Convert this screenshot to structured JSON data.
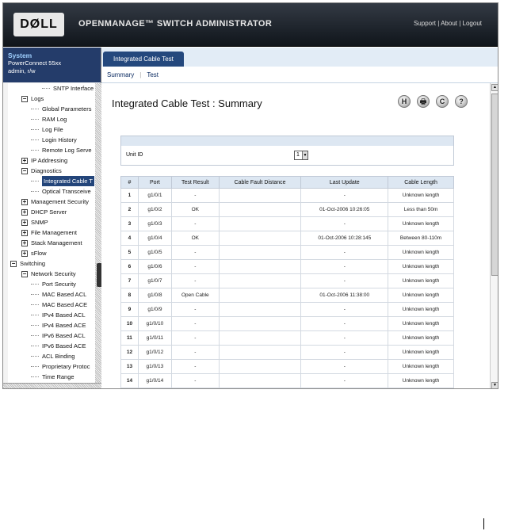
{
  "header": {
    "logo": "DØLL",
    "app_title": "OPENMANAGE™ SWITCH ADMINISTRATOR",
    "links": [
      "Support",
      "About",
      "Logout"
    ]
  },
  "system": {
    "title": "System",
    "model": "PowerConnect 55xx",
    "user": "admin, r/w"
  },
  "tree": [
    {
      "label": "SNTP Interface Se",
      "indent": 3,
      "box": ""
    },
    {
      "label": "Logs",
      "indent": 1,
      "box": "−"
    },
    {
      "label": "Global Parameters",
      "indent": 2,
      "box": ""
    },
    {
      "label": "RAM Log",
      "indent": 2,
      "box": ""
    },
    {
      "label": "Log File",
      "indent": 2,
      "box": ""
    },
    {
      "label": "Login History",
      "indent": 2,
      "box": ""
    },
    {
      "label": "Remote Log Serve",
      "indent": 2,
      "box": ""
    },
    {
      "label": "IP Addressing",
      "indent": 1,
      "box": "+"
    },
    {
      "label": "Diagnostics",
      "indent": 1,
      "box": "−"
    },
    {
      "label": "Integrated Cable T",
      "indent": 2,
      "box": "",
      "selected": true
    },
    {
      "label": "Optical Transceive",
      "indent": 2,
      "box": ""
    },
    {
      "label": "Management Security",
      "indent": 1,
      "box": "+"
    },
    {
      "label": "DHCP Server",
      "indent": 1,
      "box": "+"
    },
    {
      "label": "SNMP",
      "indent": 1,
      "box": "+"
    },
    {
      "label": "File Management",
      "indent": 1,
      "box": "+"
    },
    {
      "label": "Stack Management",
      "indent": 1,
      "box": "+"
    },
    {
      "label": "sFlow",
      "indent": 1,
      "box": "+"
    },
    {
      "label": "Switching",
      "indent": 0,
      "box": "−"
    },
    {
      "label": "Network Security",
      "indent": 1,
      "box": "−"
    },
    {
      "label": "Port Security",
      "indent": 2,
      "box": ""
    },
    {
      "label": "MAC Based ACL",
      "indent": 2,
      "box": ""
    },
    {
      "label": "MAC Based ACE",
      "indent": 2,
      "box": ""
    },
    {
      "label": "IPv4 Based ACL",
      "indent": 2,
      "box": ""
    },
    {
      "label": "IPv4 Based ACE",
      "indent": 2,
      "box": ""
    },
    {
      "label": "IPv6 Based ACL",
      "indent": 2,
      "box": ""
    },
    {
      "label": "IPv6 Based ACE",
      "indent": 2,
      "box": ""
    },
    {
      "label": "ACL Binding",
      "indent": 2,
      "box": ""
    },
    {
      "label": "Proprietary Protoc",
      "indent": 2,
      "box": ""
    },
    {
      "label": "Time Range",
      "indent": 2,
      "box": ""
    }
  ],
  "tab": {
    "label": "Integrated Cable Test"
  },
  "subnav": {
    "summary": "Summary",
    "test": "Test"
  },
  "page": {
    "title": "Integrated Cable Test : Summary"
  },
  "icons": {
    "save": "H",
    "print": "🖶",
    "refresh": "C",
    "help": "?"
  },
  "unit": {
    "label": "Unit ID",
    "value": "1"
  },
  "table": {
    "headers": [
      "#",
      "Port",
      "Test Result",
      "Cable Fault Distance",
      "Last Update",
      "Cable Length"
    ],
    "rows": [
      [
        "1",
        "g1/0/1",
        "-",
        "",
        "-",
        "Unknown length"
      ],
      [
        "2",
        "g1/0/2",
        "OK",
        "",
        "01-Oct-2006 10:26:05",
        "Less than 50m"
      ],
      [
        "3",
        "g1/0/3",
        "-",
        "",
        "-",
        "Unknown length"
      ],
      [
        "4",
        "g1/0/4",
        "OK",
        "",
        "01-Oct-2006 10:28:145",
        "Between 80-110m"
      ],
      [
        "5",
        "g1/0/5",
        "-",
        "",
        "-",
        "Unknown length"
      ],
      [
        "6",
        "g1/0/6",
        "-",
        "",
        "-",
        "Unknown length"
      ],
      [
        "7",
        "g1/0/7",
        "-",
        "",
        "-",
        "Unknown length"
      ],
      [
        "8",
        "g1/0/8",
        "Open Cable",
        "",
        "01-Oct-2006 11:38:00",
        "Unknown length"
      ],
      [
        "9",
        "g1/0/9",
        "-",
        "",
        "-",
        "Unknown length"
      ],
      [
        "10",
        "g1/0/10",
        "-",
        "",
        "-",
        "Unknown length"
      ],
      [
        "11",
        "g1/0/11",
        "-",
        "",
        "-",
        "Unknown length"
      ],
      [
        "12",
        "g1/0/12",
        "-",
        "",
        "-",
        "Unknown length"
      ],
      [
        "13",
        "g1/0/13",
        "-",
        "",
        "-",
        "Unknown length"
      ],
      [
        "14",
        "g1/0/14",
        "-",
        "",
        "-",
        "Unknown length"
      ]
    ]
  }
}
